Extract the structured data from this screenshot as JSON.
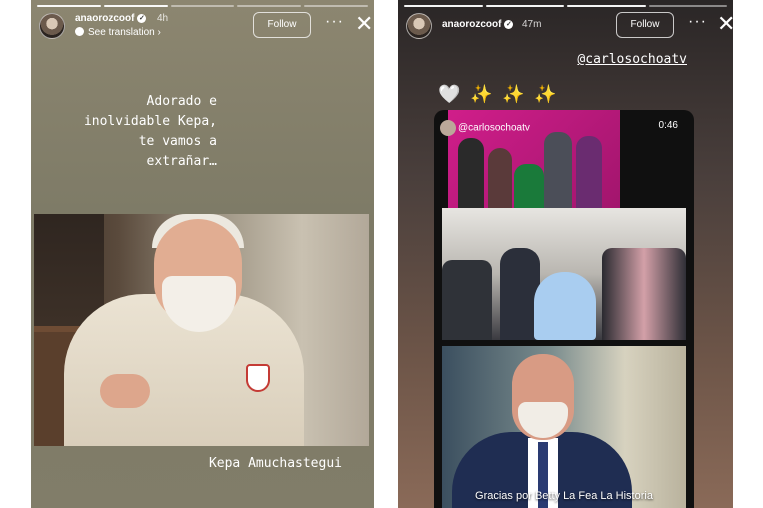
{
  "left_story": {
    "username": "anaorozcoof",
    "time": "4h",
    "see_translation": "See translation ›",
    "follow_label": "Follow",
    "more_label": "···",
    "close_label": "✕",
    "caption": "Adorado e\ninolvidable Kepa,\nte vamos a\nextrañar…",
    "photo_caption": "Kepa Amuchastegui"
  },
  "right_story": {
    "username": "anaorozcoof",
    "time": "47m",
    "follow_label": "Follow",
    "more_label": "···",
    "close_label": "✕",
    "mention": "@carlosochoatv",
    "emoji_heart": "🤍",
    "emoji_sparkles": "✨ ✨ ✨",
    "reel_handle": "@carlosochoatv",
    "reel_timer": "0:46",
    "reel_subtitle": "Gracias por Betty La Fea La Historia"
  },
  "colors": {
    "left_bg": "#827e69",
    "right_bg": "#4a3f3c",
    "text": "#ffffff"
  }
}
